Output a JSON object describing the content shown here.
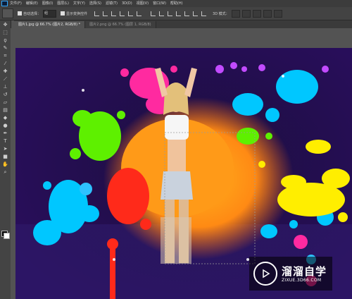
{
  "menubar": {
    "app_icon": "photoshop-logo-icon",
    "items": [
      "文件(F)",
      "编辑(E)",
      "图像(I)",
      "图层(L)",
      "文字(Y)",
      "选择(S)",
      "滤镜(T)",
      "3D(D)",
      "视图(V)",
      "窗口(W)",
      "帮助(H)"
    ]
  },
  "options": {
    "tool_icon": "move-tool-icon",
    "auto_select_label": "自动选择：",
    "auto_select_value": "组",
    "transform_label": "显示变换控件",
    "mode_label": "3D 模式："
  },
  "tabs": [
    {
      "label": "图片1.jpg @ 66.7% (图片2, RGB/8) *",
      "active": true
    },
    {
      "label": "图片2.png @ 66.7% (图层 1, RGB/8)",
      "active": false
    }
  ],
  "tools": [
    "move-icon",
    "marquee-icon",
    "lasso-icon",
    "quick-select-icon",
    "crop-icon",
    "eyedropper-icon",
    "healing-icon",
    "brush-icon",
    "stamp-icon",
    "history-brush-icon",
    "eraser-icon",
    "gradient-icon",
    "blur-icon",
    "dodge-icon",
    "pen-icon",
    "type-icon",
    "path-select-icon",
    "shape-icon",
    "hand-icon",
    "zoom-icon"
  ],
  "watermark": {
    "title": "溜溜自学",
    "url": "ZIXUE.3D66.COM"
  },
  "colors": {
    "accent": "#31a8ff",
    "canvas_bg": "#2a0e5e"
  }
}
